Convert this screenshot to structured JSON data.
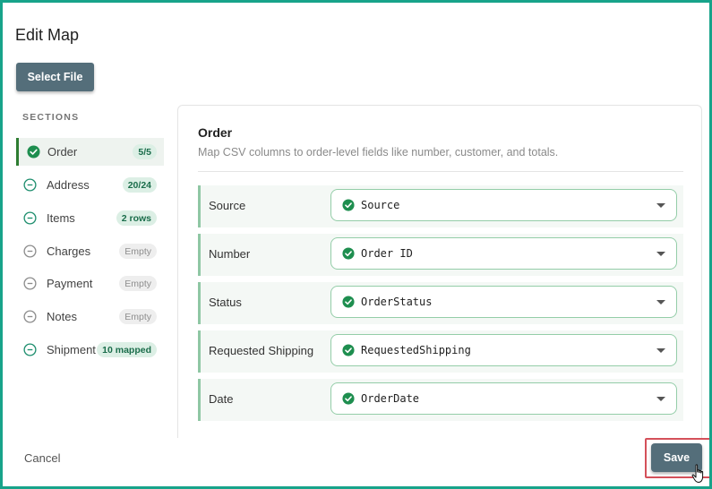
{
  "page": {
    "title": "Edit Map",
    "select_file_label": "Select File",
    "accent_color": "#17a38a"
  },
  "sidebar": {
    "heading": "SECTIONS",
    "items": [
      {
        "label": "Order",
        "badge": "5/5",
        "status": "complete",
        "active": true
      },
      {
        "label": "Address",
        "badge": "20/24",
        "status": "partial"
      },
      {
        "label": "Items",
        "badge": "2 rows",
        "status": "partial"
      },
      {
        "label": "Charges",
        "badge": "Empty",
        "status": "empty"
      },
      {
        "label": "Payment",
        "badge": "Empty",
        "status": "empty"
      },
      {
        "label": "Notes",
        "badge": "Empty",
        "status": "empty"
      },
      {
        "label": "Shipment",
        "badge": "10 mapped",
        "status": "partial"
      }
    ]
  },
  "panel": {
    "title": "Order",
    "description": "Map CSV columns to order-level fields like number, customer, and totals.",
    "fields": [
      {
        "label": "Source",
        "value": "Source"
      },
      {
        "label": "Number",
        "value": "Order ID"
      },
      {
        "label": "Status",
        "value": "OrderStatus"
      },
      {
        "label": "Requested Shipping",
        "value": "RequestedShipping"
      },
      {
        "label": "Date",
        "value": "OrderDate"
      }
    ]
  },
  "footer": {
    "cancel_label": "Cancel",
    "save_label": "Save"
  },
  "icons": {
    "complete": "check-circle-icon",
    "partial": "minus-circle-icon",
    "empty": "minus-circle-icon",
    "field": "check-circle-icon",
    "dropdown": "caret-down-icon",
    "cursor": "hand-pointer-icon"
  }
}
